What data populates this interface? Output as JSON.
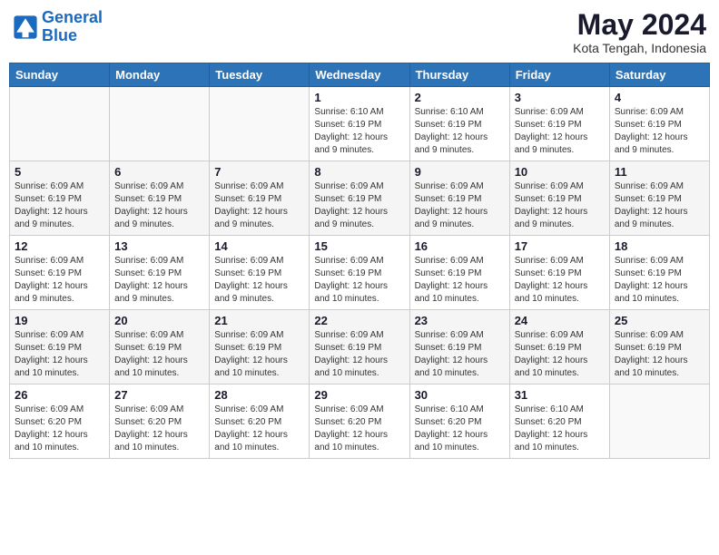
{
  "header": {
    "logo_line1": "General",
    "logo_line2": "Blue",
    "month_year": "May 2024",
    "location": "Kota Tengah, Indonesia"
  },
  "days_of_week": [
    "Sunday",
    "Monday",
    "Tuesday",
    "Wednesday",
    "Thursday",
    "Friday",
    "Saturday"
  ],
  "weeks": [
    [
      {
        "day": "",
        "info": ""
      },
      {
        "day": "",
        "info": ""
      },
      {
        "day": "",
        "info": ""
      },
      {
        "day": "1",
        "info": "Sunrise: 6:10 AM\nSunset: 6:19 PM\nDaylight: 12 hours and 9 minutes."
      },
      {
        "day": "2",
        "info": "Sunrise: 6:10 AM\nSunset: 6:19 PM\nDaylight: 12 hours and 9 minutes."
      },
      {
        "day": "3",
        "info": "Sunrise: 6:09 AM\nSunset: 6:19 PM\nDaylight: 12 hours and 9 minutes."
      },
      {
        "day": "4",
        "info": "Sunrise: 6:09 AM\nSunset: 6:19 PM\nDaylight: 12 hours and 9 minutes."
      }
    ],
    [
      {
        "day": "5",
        "info": "Sunrise: 6:09 AM\nSunset: 6:19 PM\nDaylight: 12 hours and 9 minutes."
      },
      {
        "day": "6",
        "info": "Sunrise: 6:09 AM\nSunset: 6:19 PM\nDaylight: 12 hours and 9 minutes."
      },
      {
        "day": "7",
        "info": "Sunrise: 6:09 AM\nSunset: 6:19 PM\nDaylight: 12 hours and 9 minutes."
      },
      {
        "day": "8",
        "info": "Sunrise: 6:09 AM\nSunset: 6:19 PM\nDaylight: 12 hours and 9 minutes."
      },
      {
        "day": "9",
        "info": "Sunrise: 6:09 AM\nSunset: 6:19 PM\nDaylight: 12 hours and 9 minutes."
      },
      {
        "day": "10",
        "info": "Sunrise: 6:09 AM\nSunset: 6:19 PM\nDaylight: 12 hours and 9 minutes."
      },
      {
        "day": "11",
        "info": "Sunrise: 6:09 AM\nSunset: 6:19 PM\nDaylight: 12 hours and 9 minutes."
      }
    ],
    [
      {
        "day": "12",
        "info": "Sunrise: 6:09 AM\nSunset: 6:19 PM\nDaylight: 12 hours and 9 minutes."
      },
      {
        "day": "13",
        "info": "Sunrise: 6:09 AM\nSunset: 6:19 PM\nDaylight: 12 hours and 9 minutes."
      },
      {
        "day": "14",
        "info": "Sunrise: 6:09 AM\nSunset: 6:19 PM\nDaylight: 12 hours and 9 minutes."
      },
      {
        "day": "15",
        "info": "Sunrise: 6:09 AM\nSunset: 6:19 PM\nDaylight: 12 hours and 10 minutes."
      },
      {
        "day": "16",
        "info": "Sunrise: 6:09 AM\nSunset: 6:19 PM\nDaylight: 12 hours and 10 minutes."
      },
      {
        "day": "17",
        "info": "Sunrise: 6:09 AM\nSunset: 6:19 PM\nDaylight: 12 hours and 10 minutes."
      },
      {
        "day": "18",
        "info": "Sunrise: 6:09 AM\nSunset: 6:19 PM\nDaylight: 12 hours and 10 minutes."
      }
    ],
    [
      {
        "day": "19",
        "info": "Sunrise: 6:09 AM\nSunset: 6:19 PM\nDaylight: 12 hours and 10 minutes."
      },
      {
        "day": "20",
        "info": "Sunrise: 6:09 AM\nSunset: 6:19 PM\nDaylight: 12 hours and 10 minutes."
      },
      {
        "day": "21",
        "info": "Sunrise: 6:09 AM\nSunset: 6:19 PM\nDaylight: 12 hours and 10 minutes."
      },
      {
        "day": "22",
        "info": "Sunrise: 6:09 AM\nSunset: 6:19 PM\nDaylight: 12 hours and 10 minutes."
      },
      {
        "day": "23",
        "info": "Sunrise: 6:09 AM\nSunset: 6:19 PM\nDaylight: 12 hours and 10 minutes."
      },
      {
        "day": "24",
        "info": "Sunrise: 6:09 AM\nSunset: 6:19 PM\nDaylight: 12 hours and 10 minutes."
      },
      {
        "day": "25",
        "info": "Sunrise: 6:09 AM\nSunset: 6:19 PM\nDaylight: 12 hours and 10 minutes."
      }
    ],
    [
      {
        "day": "26",
        "info": "Sunrise: 6:09 AM\nSunset: 6:20 PM\nDaylight: 12 hours and 10 minutes."
      },
      {
        "day": "27",
        "info": "Sunrise: 6:09 AM\nSunset: 6:20 PM\nDaylight: 12 hours and 10 minutes."
      },
      {
        "day": "28",
        "info": "Sunrise: 6:09 AM\nSunset: 6:20 PM\nDaylight: 12 hours and 10 minutes."
      },
      {
        "day": "29",
        "info": "Sunrise: 6:09 AM\nSunset: 6:20 PM\nDaylight: 12 hours and 10 minutes."
      },
      {
        "day": "30",
        "info": "Sunrise: 6:10 AM\nSunset: 6:20 PM\nDaylight: 12 hours and 10 minutes."
      },
      {
        "day": "31",
        "info": "Sunrise: 6:10 AM\nSunset: 6:20 PM\nDaylight: 12 hours and 10 minutes."
      },
      {
        "day": "",
        "info": ""
      }
    ]
  ]
}
